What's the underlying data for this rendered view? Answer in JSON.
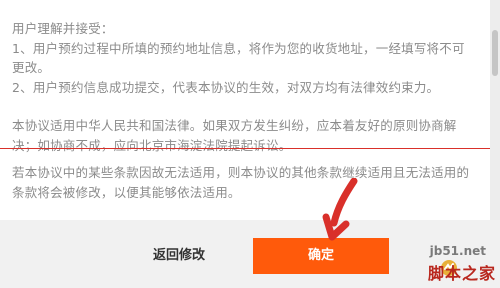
{
  "agreement": {
    "paragraph1": "用户理解并接受：\n1、用户预约过程中所填的预约地址信息，将作为您的收货地址，一经填写将不可更改。\n2、用户预约信息成功提交，代表本协议的生效，对双方均有法律效约束力。",
    "paragraph2": "本协议适用中华人民共和国法律。如果双方发生纠纷，应本着友好的原则协商解决；如协商不成，应向北京市海淀法院提起诉讼。",
    "paragraph3": "若本协议中的某些条款因故无法适用，则本协议的其他条款继续适用且无法适用的条款将会被修改，以便其能够依法适用。"
  },
  "footer": {
    "back_label": "返回修改",
    "confirm_label": "确定"
  },
  "colors": {
    "confirm": "#ff5a0b",
    "annotation": "#d9302a",
    "text": "#8b8b8b"
  },
  "watermark": {
    "url": "jb51.net",
    "text": "脚本之家"
  }
}
